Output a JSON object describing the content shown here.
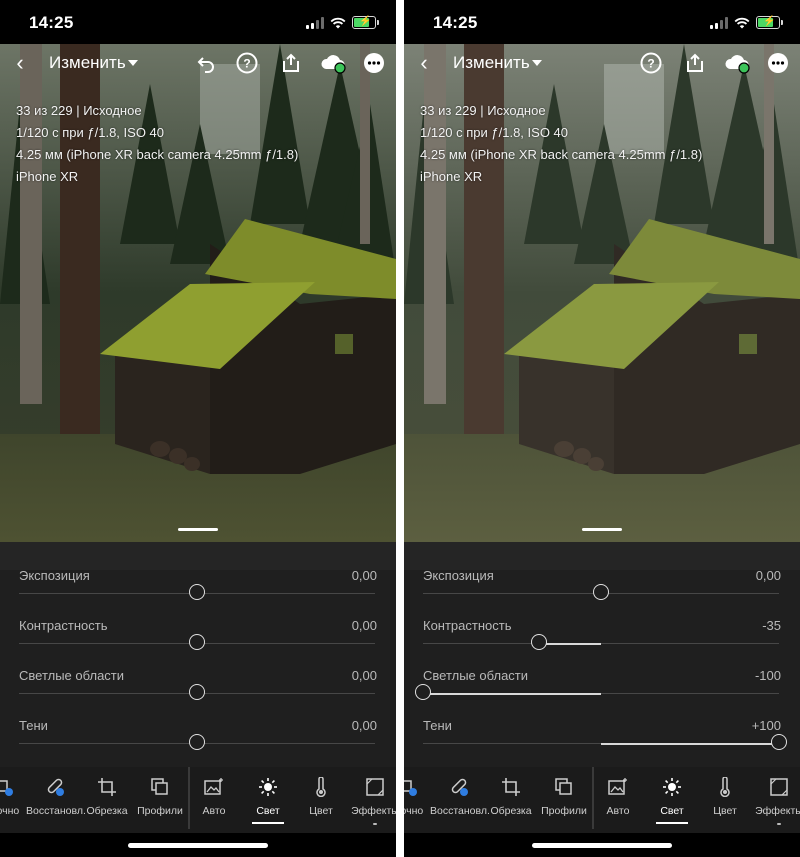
{
  "status": {
    "time": "14:25"
  },
  "topbar": {
    "mode_title": "Изменить"
  },
  "photo_info": {
    "line1": "33 из 229 | Исходное",
    "line2": "1/120 с при ƒ/1.8, ISO 40",
    "line3": "4.25 мм (iPhone XR back camera 4.25mm ƒ/1.8)",
    "line4": "iPhone XR"
  },
  "icons": {
    "back": "chevron-left-icon",
    "undo": "undo-icon",
    "help": "help-icon",
    "share": "share-icon",
    "cloud": "cloud-sync-icon",
    "more": "more-icon"
  },
  "colors": {
    "cloud_status": "#3cc45a",
    "battery": "#4cd964",
    "panel": "#1f1f1f"
  },
  "screens": [
    {
      "sliders": [
        {
          "label": "Экспозиция",
          "value": "0,00",
          "level": 0
        },
        {
          "label": "Контрастность",
          "value": "0,00",
          "level": 0
        },
        {
          "label": "Светлые области",
          "value": "0,00",
          "level": 0
        },
        {
          "label": "Тени",
          "value": "0,00",
          "level": 0
        }
      ]
    },
    {
      "sliders": [
        {
          "label": "Экспозиция",
          "value": "0,00",
          "level": 0
        },
        {
          "label": "Контрастность",
          "value": "-35",
          "level": -35
        },
        {
          "label": "Светлые области",
          "value": "-100",
          "level": -100
        },
        {
          "label": "Тени",
          "value": "+100",
          "level": 100
        }
      ]
    }
  ],
  "toolbar": {
    "items": [
      {
        "label": "рочно",
        "icon": "quick-edit-icon"
      },
      {
        "label": "Восстановл.",
        "icon": "healing-icon"
      },
      {
        "label": "Обрезка",
        "icon": "crop-icon"
      },
      {
        "label": "Профили",
        "icon": "profiles-icon"
      },
      {
        "label": "Авто",
        "icon": "auto-icon"
      },
      {
        "label": "Свет",
        "icon": "light-icon"
      },
      {
        "label": "Цвет",
        "icon": "color-icon"
      },
      {
        "label": "Эффекты",
        "icon": "effects-icon"
      }
    ],
    "active_index": 5
  }
}
